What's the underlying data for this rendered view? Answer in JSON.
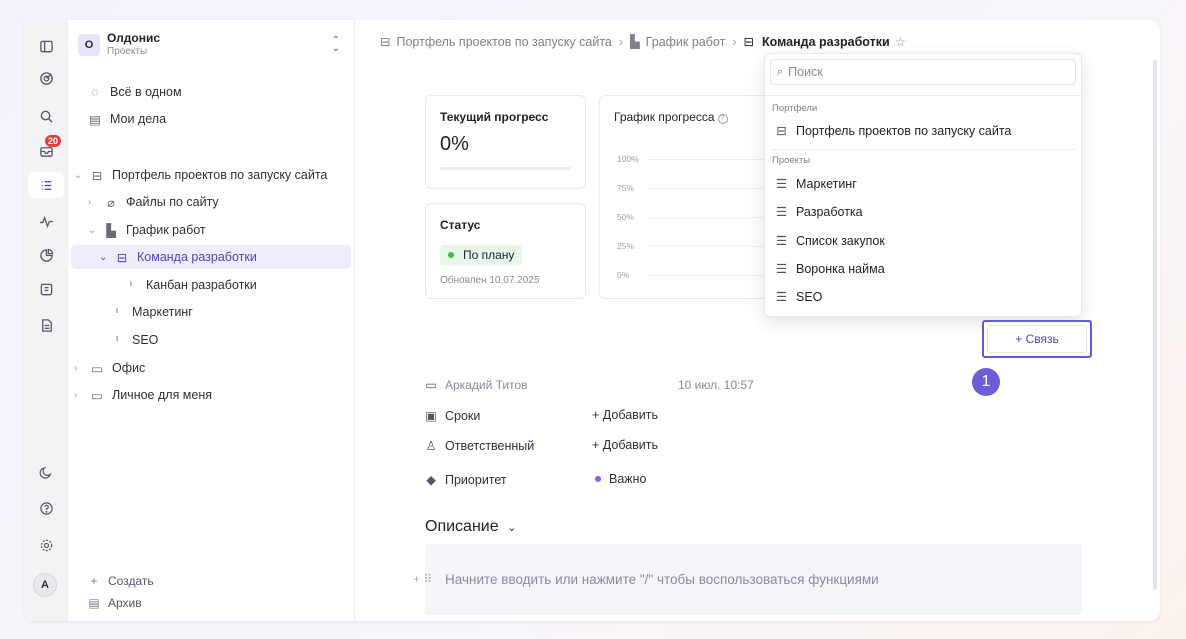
{
  "workspace": {
    "initial": "О",
    "name": "Олдонис",
    "subtitle": "Проекты"
  },
  "rail": {
    "badge_count": "20",
    "avatar": "A"
  },
  "sidebar": {
    "top_items": [
      {
        "label": "Всё в одном",
        "icon": "all-in-one-icon"
      },
      {
        "label": "Мои дела",
        "icon": "inbox-icon"
      }
    ],
    "tree": [
      {
        "label": "Портфель проектов по запуску сайта",
        "icon": "briefcase-icon"
      },
      {
        "label": "Файлы по сайту",
        "icon": "paperclip-icon"
      },
      {
        "label": "График работ",
        "icon": "gantt-icon"
      },
      {
        "label": "Команда разработки",
        "icon": "briefcase-icon"
      },
      {
        "label": "Канбан разработки",
        "icon": "kanban-icon"
      },
      {
        "label": "Маркетинг",
        "icon": "kanban-icon"
      },
      {
        "label": "SEO",
        "icon": "kanban-icon"
      },
      {
        "label": "Офис",
        "icon": "folder-icon"
      },
      {
        "label": "Личное для меня",
        "icon": "folder-icon"
      }
    ],
    "create_label": "Создать",
    "archive_label": "Архив"
  },
  "breadcrumb": {
    "items": [
      "Портфель проектов по запуску сайта",
      "График работ"
    ],
    "current": "Команда разработки"
  },
  "progress_card": {
    "title": "Текущий прогресс",
    "value": "0%",
    "progress": 0
  },
  "status_card": {
    "title": "Статус",
    "status": "По плану",
    "status_color": "#3fb950",
    "updated": "Обновлен 10.07.2025"
  },
  "chart_card": {
    "title": "График прогресса",
    "y_ticks": [
      "100%",
      "75%",
      "50%",
      "25%",
      "0%"
    ]
  },
  "chart_data": {
    "type": "line",
    "title": "График прогресса",
    "y_tick_labels": [
      "100%",
      "75%",
      "50%",
      "25%",
      "0%"
    ],
    "ylim": [
      0,
      100
    ],
    "series": []
  },
  "dropdown": {
    "search_placeholder": "Поиск",
    "groups": [
      {
        "label": "Портфели",
        "items": [
          {
            "label": "Портфель проектов по запуску сайта",
            "icon": "briefcase-icon"
          }
        ]
      },
      {
        "label": "Проекты",
        "items": [
          {
            "label": "Маркетинг",
            "icon": "list-icon"
          },
          {
            "label": "Разработка",
            "icon": "list-icon"
          },
          {
            "label": "Список закупок",
            "icon": "list-icon"
          },
          {
            "label": "Воронка найма",
            "icon": "list-icon"
          },
          {
            "label": "SEO",
            "icon": "list-icon"
          }
        ]
      }
    ]
  },
  "link_button": {
    "label": "+ Связь"
  },
  "step_marker": "1",
  "meta": {
    "author": "Аркадий Титов",
    "created": "10 июл. 10:57",
    "deadlines_label": "Сроки",
    "deadlines_value": "+ Добавить",
    "assignee_label": "Ответственный",
    "assignee_value": "+ Добавить",
    "priority_label": "Приоритет",
    "priority_value": "Важно",
    "priority_color": "#8b5cf6"
  },
  "description": {
    "title": "Описание",
    "placeholder": "Начните вводить или нажмите \"/\" чтобы воспользоваться функциями"
  }
}
